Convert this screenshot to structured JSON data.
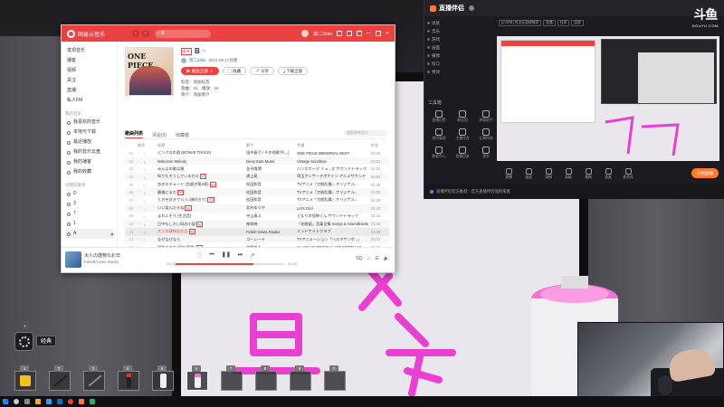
{
  "music_app": {
    "title": "网易云音乐",
    "search_text": "B",
    "user_name": "烧二Zinki",
    "sidebar": {
      "items": [
        "发现音乐",
        "播客",
        "视频",
        "关注",
        "直播",
        "私人FM"
      ],
      "my_music_title": "我的音乐",
      "my_music_items": [
        "我喜欢的音乐",
        "本地与下载",
        "最近播放",
        "我的音乐云盘",
        "我的播客",
        "我的收藏"
      ],
      "created_title": "创建的歌单 ",
      "created_items": [
        "D",
        "3",
        "7",
        "1",
        "A"
      ]
    },
    "playlist": {
      "cover_text": "ONE PIECE",
      "tag": "歌单",
      "title": "B",
      "creator": "烧二Zinki",
      "created_date": "2021-08-17创建",
      "play_all": "播放全部",
      "collect": "收藏",
      "share": "分享",
      "download": "下载全部",
      "meta": [
        "标签：添加标签",
        "歌曲：21　播放：16",
        "简介：添加简介"
      ]
    },
    "tabs": [
      "歌曲列表",
      "评论(0)",
      "收藏者"
    ],
    "filter_placeholder": "搜索歌单音乐",
    "columns": [
      "",
      "操作",
      "标题",
      "歌手",
      "专辑",
      "时长"
    ],
    "songs": [
      {
        "no": "01",
        "title": "ビンクスの酒 (BONUS TRACK)",
        "sq": false,
        "artist": "田中真弓 / その他歌手(...)",
        "album": "ONE PIECE MEMORIAL BEST",
        "dur": "02:26"
      },
      {
        "no": "02",
        "title": "Welcome Melody",
        "sq": false,
        "artist": "Deep East Music",
        "album": "Vintage Sunshine",
        "dur": "02:01"
      },
      {
        "no": "03",
        "title": "みんなの歌は僕",
        "sq": false,
        "artist": "金子隆博",
        "album": "ハンズホーグ ミュ...ズ サウンドトラック",
        "dur": "01:31"
      },
      {
        "no": "04",
        "title": "知りたそうしているかえ",
        "sq": true,
        "artist": "浦上晃",
        "album": "埼玉アンサーチポケイン アニメサウンド",
        "dur": "03:54"
      },
      {
        "no": "05",
        "title": "恋のエチュード (恋愛の第2章)",
        "sq": true,
        "artist": "松田和音",
        "album": "TVアニメ「刀剣乱舞」オリジナル...",
        "dur": "01:26"
      },
      {
        "no": "06",
        "title": "最後にまた",
        "sq": true,
        "artist": "松田和音",
        "album": "TVアニメ「刀剣乱舞」オリジナル...",
        "dur": "01:05"
      },
      {
        "no": "07",
        "title": "ときを好きで (いい顔好きで)",
        "sq": true,
        "artist": "松田和音",
        "album": "TVアニメ「刀剣乱舞」オリジナル...",
        "dur": "01:49"
      },
      {
        "no": "08",
        "title": "いい笑んたえね",
        "sq": true,
        "artist": "北村ゆうや",
        "album": "Let's Go!!",
        "dur": "01:24"
      },
      {
        "no": "09",
        "title": "まわふそり (生活音)",
        "sq": false,
        "artist": "中山真斗",
        "album": "となりの怪物くん サウンドトラック",
        "dur": "02:41"
      },
      {
        "no": "10",
        "title": "日中もしたい同の小説",
        "sq": true,
        "artist": "神前暁",
        "album": "「化物語」音楽全集 Songs & Soundtracks",
        "dur": "01:26"
      },
      {
        "no": "11",
        "title": "大人の建物なお日",
        "sq": true,
        "artist": "Fetish Grass Studio",
        "album": "ミッドナイトクラブ",
        "dur": "02:48"
      },
      {
        "no": "12",
        "title": "なぜなぜなら",
        "sq": false,
        "artist": "ゴーシーヤ",
        "album": "TVアニメーション「ハルヲサンポ...」",
        "dur": "03:02"
      },
      {
        "no": "13",
        "title": "風吹るかな (呼び音楽)",
        "sq": true,
        "artist": "大野克夫",
        "album": "CLANNAD ORIGINAL SOUNDTRACK",
        "dur": "01:46"
      }
    ],
    "now_playing": {
      "title": "大人の建物なお日",
      "artist": "FetishGrass Studio",
      "elapsed": "00:12",
      "total": "02:48",
      "progress": 0.72
    }
  },
  "stream_app": {
    "title": "直播伴侣",
    "watermark_big": "斗鱼",
    "watermark_small": "DOUYU.COM",
    "scene_items": [
      "场景",
      "音乐",
      "游戏",
      "画面",
      "摄像",
      "窗口",
      "特效"
    ],
    "preview_chips": [
      "[小伙伴] 专注玩游戏推荐",
      "直播",
      "分享",
      "竖屏"
    ],
    "tools_title": "工具箱",
    "tools": [
      "直播设置",
      "粉丝团",
      "弹幕助手",
      "房间管理",
      "主播任务",
      "礼物特效",
      "数据中心",
      "直播回放",
      "更多"
    ],
    "bottom_buttons": [
      "直播",
      "画面",
      "录制",
      "高级",
      "美颜",
      "连麦",
      "麦克风"
    ],
    "go_live": "开始直播",
    "notice": "直播伴侣官方推荐：官方直播伴侣强势来袭"
  },
  "hud": {
    "key_hint": "F",
    "mode_label": "经典",
    "slots": [
      "1",
      "2",
      "3",
      "4",
      "5",
      "6",
      "7",
      "8",
      "9",
      "0"
    ],
    "selected_slot": 6
  },
  "whiteboard": {
    "scribble_color": "#ea3fd2"
  }
}
